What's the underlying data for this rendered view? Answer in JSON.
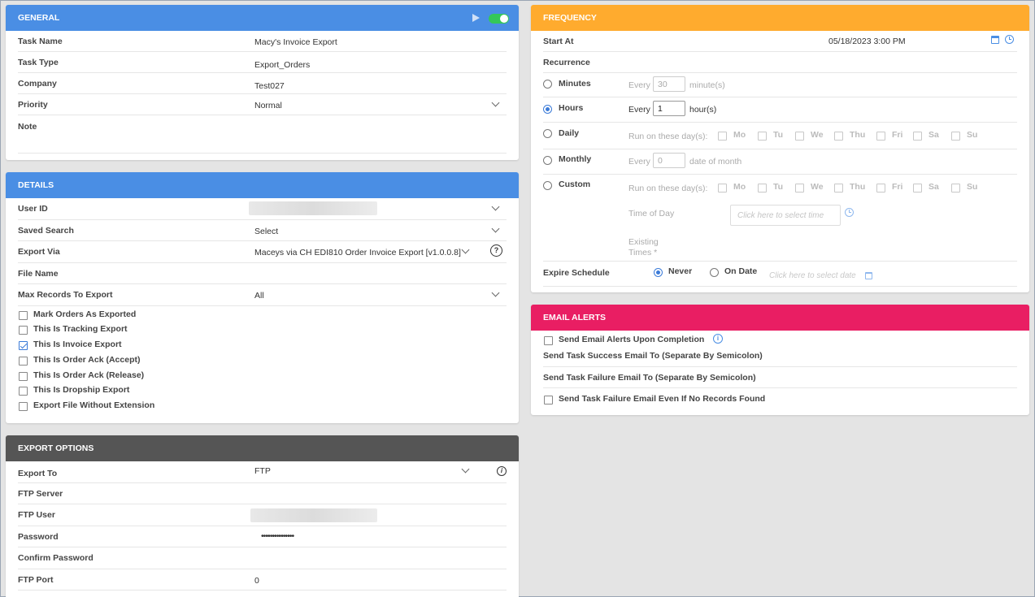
{
  "general": {
    "title": "GENERAL",
    "rows": [
      {
        "label": "Task Name",
        "value": "Macy's Invoice Export"
      },
      {
        "label": "Task Type",
        "value": "Export_Orders"
      },
      {
        "label": "Company",
        "value": "Test027"
      },
      {
        "label": "Priority",
        "value": "Normal"
      },
      {
        "label": "Note",
        "value": ""
      }
    ]
  },
  "details": {
    "title": "DETAILS",
    "user_id_label": "User ID",
    "saved_search_label": "Saved Search",
    "saved_search_value": "Select",
    "export_via_label": "Export Via",
    "export_via_value": "Maceys via CH EDI810 Order Invoice Export [v1.0.0.8]",
    "file_name_label": "File Name",
    "max_records_label": "Max Records To Export",
    "max_records_value": "All",
    "checkboxes": [
      {
        "label": "Mark Orders As Exported",
        "checked": false
      },
      {
        "label": "This Is Tracking Export",
        "checked": false
      },
      {
        "label": "This Is Invoice Export",
        "checked": true
      },
      {
        "label": "This Is Order Ack (Accept)",
        "checked": false
      },
      {
        "label": "This Is Order Ack (Release)",
        "checked": false
      },
      {
        "label": "This Is Dropship Export",
        "checked": false
      },
      {
        "label": "Export File Without Extension",
        "checked": false
      }
    ]
  },
  "export_options": {
    "title": "EXPORT OPTIONS",
    "export_to_label": "Export To",
    "export_to_value": "FTP",
    "ftp_server_label": "FTP Server",
    "ftp_user_label": "FTP User",
    "password_label": "Password",
    "password_value": "•••••••••••••••",
    "confirm_password_label": "Confirm Password",
    "ftp_port_label": "FTP Port",
    "ftp_port_value": "0"
  },
  "frequency": {
    "title": "FREQUENCY",
    "start_at_label": "Start At",
    "start_at_value": "05/18/2023 3:00 PM",
    "recurrence_label": "Recurrence",
    "minutes_label": "Minutes",
    "hours_label": "Hours",
    "daily_label": "Daily",
    "monthly_label": "Monthly",
    "custom_label": "Custom",
    "every_label": "Every",
    "minutes_value": "30",
    "minutes_unit": "minute(s)",
    "hours_value": "1",
    "hours_unit": "hour(s)",
    "run_on_label": "Run on these day(s):",
    "days": [
      "Mo",
      "Tu",
      "We",
      "Thu",
      "Fri",
      "Sa",
      "Su"
    ],
    "monthly_value": "0",
    "monthly_unit": "date of month",
    "time_of_day_label": "Time of Day",
    "time_placeholder": "Click here to select time",
    "existing_times_label_1": "Existing",
    "existing_times_label_2": "Times *",
    "expire_label": "Expire Schedule",
    "never_label": "Never",
    "on_date_label": "On Date",
    "date_placeholder": "Click here to select date"
  },
  "email_alerts": {
    "title": "EMAIL ALERTS",
    "send_alerts_label": "Send Email Alerts Upon Completion",
    "success_label": "Send Task Success Email To (Separate By Semicolon)",
    "failure_label": "Send Task Failure Email To (Separate By Semicolon)",
    "failure_no_records_label": "Send Task Failure Email Even If No Records Found"
  },
  "colors": {
    "general": "#4a8ee4",
    "details": "#4a8ee4",
    "export_options": "#555555",
    "frequency": "#ffab2e",
    "email_alerts": "#e91e63",
    "toggle": "#34c759"
  }
}
